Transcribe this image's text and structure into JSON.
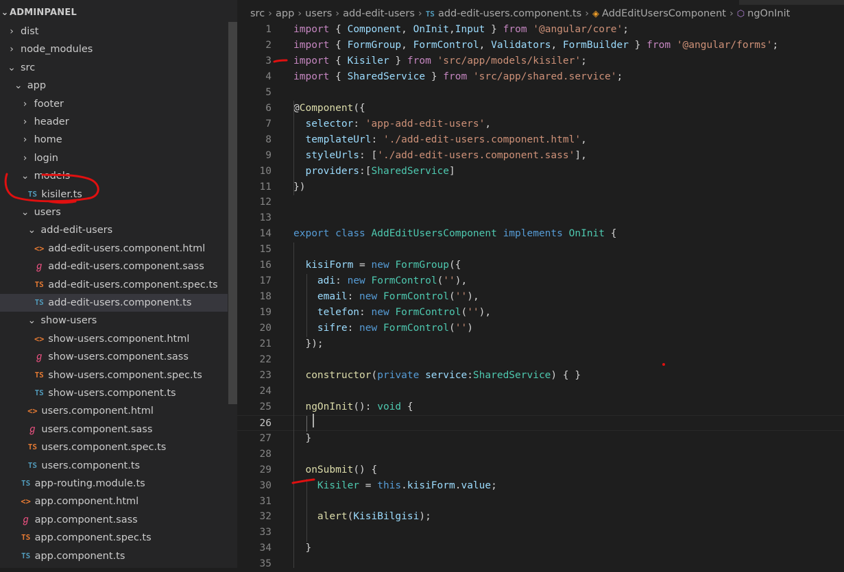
{
  "explorer": {
    "title": "ADMINPANEL",
    "items": [
      {
        "label": "dist",
        "type": "folder",
        "expanded": false,
        "depth": 0
      },
      {
        "label": "node_modules",
        "type": "folder",
        "expanded": false,
        "depth": 0
      },
      {
        "label": "src",
        "type": "folder",
        "expanded": true,
        "depth": 0
      },
      {
        "label": "app",
        "type": "folder",
        "expanded": true,
        "depth": 1
      },
      {
        "label": "footer",
        "type": "folder",
        "expanded": false,
        "depth": 2
      },
      {
        "label": "header",
        "type": "folder",
        "expanded": false,
        "depth": 2
      },
      {
        "label": "home",
        "type": "folder",
        "expanded": false,
        "depth": 2
      },
      {
        "label": "login",
        "type": "folder",
        "expanded": false,
        "depth": 2
      },
      {
        "label": "models",
        "type": "folder",
        "expanded": true,
        "depth": 2
      },
      {
        "label": "kisiler.ts",
        "type": "ts",
        "depth": 3
      },
      {
        "label": "users",
        "type": "folder",
        "expanded": true,
        "depth": 2
      },
      {
        "label": "add-edit-users",
        "type": "folder",
        "expanded": true,
        "depth": 3
      },
      {
        "label": "add-edit-users.component.html",
        "type": "html",
        "depth": 4
      },
      {
        "label": "add-edit-users.component.sass",
        "type": "sass",
        "depth": 4
      },
      {
        "label": "add-edit-users.component.spec.ts",
        "type": "spec",
        "depth": 4
      },
      {
        "label": "add-edit-users.component.ts",
        "type": "ts",
        "depth": 4,
        "selected": true
      },
      {
        "label": "show-users",
        "type": "folder",
        "expanded": true,
        "depth": 3
      },
      {
        "label": "show-users.component.html",
        "type": "html",
        "depth": 4
      },
      {
        "label": "show-users.component.sass",
        "type": "sass",
        "depth": 4
      },
      {
        "label": "show-users.component.spec.ts",
        "type": "spec",
        "depth": 4
      },
      {
        "label": "show-users.component.ts",
        "type": "ts",
        "depth": 4
      },
      {
        "label": "users.component.html",
        "type": "html",
        "depth": 3
      },
      {
        "label": "users.component.sass",
        "type": "sass",
        "depth": 3
      },
      {
        "label": "users.component.spec.ts",
        "type": "spec",
        "depth": 3
      },
      {
        "label": "users.component.ts",
        "type": "ts",
        "depth": 3
      },
      {
        "label": "app-routing.module.ts",
        "type": "ts",
        "depth": 2
      },
      {
        "label": "app.component.html",
        "type": "html",
        "depth": 2
      },
      {
        "label": "app.component.sass",
        "type": "sass",
        "depth": 2
      },
      {
        "label": "app.component.spec.ts",
        "type": "spec",
        "depth": 2
      },
      {
        "label": "app.component.ts",
        "type": "ts",
        "depth": 2
      }
    ]
  },
  "breadcrumb": {
    "parts": [
      "src",
      "app",
      "users",
      "add-edit-users"
    ],
    "file": "add-edit-users.component.ts",
    "file_icon": "TS",
    "class_name": "AddEditUsersComponent",
    "method_name": "ngOnInit"
  },
  "editor": {
    "current_line": 26,
    "lines": [
      [
        [
          "k",
          "import"
        ],
        [
          "p",
          " { "
        ],
        [
          "v",
          "Component"
        ],
        [
          "p",
          ", "
        ],
        [
          "v",
          "OnInit"
        ],
        [
          "p",
          ","
        ],
        [
          "v",
          "Input"
        ],
        [
          "p",
          " } "
        ],
        [
          "k",
          "from"
        ],
        [
          "p",
          " "
        ],
        [
          "s",
          "'@angular/core'"
        ],
        [
          "p",
          ";"
        ]
      ],
      [
        [
          "k",
          "import"
        ],
        [
          "p",
          " { "
        ],
        [
          "v",
          "FormGroup"
        ],
        [
          "p",
          ", "
        ],
        [
          "v",
          "FormControl"
        ],
        [
          "p",
          ", "
        ],
        [
          "v",
          "Validators"
        ],
        [
          "p",
          ", "
        ],
        [
          "v",
          "FormBuilder"
        ],
        [
          "p",
          " } "
        ],
        [
          "k",
          "from"
        ],
        [
          "p",
          " "
        ],
        [
          "s",
          "'@angular/forms'"
        ],
        [
          "p",
          ";"
        ]
      ],
      [
        [
          "k",
          "import"
        ],
        [
          "p",
          " { "
        ],
        [
          "v",
          "Kisiler"
        ],
        [
          "p",
          " } "
        ],
        [
          "k",
          "from"
        ],
        [
          "p",
          " "
        ],
        [
          "s",
          "'src/app/models/kisiler'"
        ],
        [
          "p",
          ";"
        ]
      ],
      [
        [
          "k",
          "import"
        ],
        [
          "p",
          " { "
        ],
        [
          "v",
          "SharedService"
        ],
        [
          "p",
          " } "
        ],
        [
          "k",
          "from"
        ],
        [
          "p",
          " "
        ],
        [
          "s",
          "'src/app/shared.service'"
        ],
        [
          "p",
          ";"
        ]
      ],
      [],
      [
        [
          "p",
          "@"
        ],
        [
          "f",
          "Component"
        ],
        [
          "p",
          "({"
        ]
      ],
      [
        [
          "p",
          "  "
        ],
        [
          "v",
          "selector"
        ],
        [
          "p",
          ": "
        ],
        [
          "s",
          "'app-add-edit-users'"
        ],
        [
          "p",
          ","
        ]
      ],
      [
        [
          "p",
          "  "
        ],
        [
          "v",
          "templateUrl"
        ],
        [
          "p",
          ": "
        ],
        [
          "s",
          "'./add-edit-users.component.html'"
        ],
        [
          "p",
          ","
        ]
      ],
      [
        [
          "p",
          "  "
        ],
        [
          "v",
          "styleUrls"
        ],
        [
          "p",
          ": ["
        ],
        [
          "s",
          "'./add-edit-users.component.sass'"
        ],
        [
          "p",
          "],"
        ]
      ],
      [
        [
          "p",
          "  "
        ],
        [
          "v",
          "providers"
        ],
        [
          "p",
          ":["
        ],
        [
          "c",
          "SharedService"
        ],
        [
          "p",
          "]"
        ]
      ],
      [
        [
          "p",
          "})"
        ]
      ],
      [],
      [],
      [
        [
          "kw",
          "export"
        ],
        [
          "p",
          " "
        ],
        [
          "kw",
          "class"
        ],
        [
          "p",
          " "
        ],
        [
          "c",
          "AddEditUsersComponent"
        ],
        [
          "p",
          " "
        ],
        [
          "kw",
          "implements"
        ],
        [
          "p",
          " "
        ],
        [
          "c",
          "OnInit"
        ],
        [
          "p",
          " {"
        ]
      ],
      [],
      [
        [
          "p",
          "  "
        ],
        [
          "v",
          "kisiForm"
        ],
        [
          "p",
          " = "
        ],
        [
          "kw",
          "new"
        ],
        [
          "p",
          " "
        ],
        [
          "c",
          "FormGroup"
        ],
        [
          "p",
          "({"
        ]
      ],
      [
        [
          "p",
          "    "
        ],
        [
          "v",
          "adi"
        ],
        [
          "p",
          ": "
        ],
        [
          "kw",
          "new"
        ],
        [
          "p",
          " "
        ],
        [
          "c",
          "FormControl"
        ],
        [
          "p",
          "("
        ],
        [
          "s",
          "''"
        ],
        [
          "p",
          "),"
        ]
      ],
      [
        [
          "p",
          "    "
        ],
        [
          "v",
          "email"
        ],
        [
          "p",
          ": "
        ],
        [
          "kw",
          "new"
        ],
        [
          "p",
          " "
        ],
        [
          "c",
          "FormControl"
        ],
        [
          "p",
          "("
        ],
        [
          "s",
          "''"
        ],
        [
          "p",
          "),"
        ]
      ],
      [
        [
          "p",
          "    "
        ],
        [
          "v",
          "telefon"
        ],
        [
          "p",
          ": "
        ],
        [
          "kw",
          "new"
        ],
        [
          "p",
          " "
        ],
        [
          "c",
          "FormControl"
        ],
        [
          "p",
          "("
        ],
        [
          "s",
          "''"
        ],
        [
          "p",
          "),"
        ]
      ],
      [
        [
          "p",
          "    "
        ],
        [
          "v",
          "sifre"
        ],
        [
          "p",
          ": "
        ],
        [
          "kw",
          "new"
        ],
        [
          "p",
          " "
        ],
        [
          "c",
          "FormControl"
        ],
        [
          "p",
          "("
        ],
        [
          "s",
          "''"
        ],
        [
          "p",
          ")"
        ]
      ],
      [
        [
          "p",
          "  });"
        ]
      ],
      [],
      [
        [
          "p",
          "  "
        ],
        [
          "f",
          "constructor"
        ],
        [
          "p",
          "("
        ],
        [
          "kw",
          "private"
        ],
        [
          "p",
          " "
        ],
        [
          "v",
          "service"
        ],
        [
          "p",
          ":"
        ],
        [
          "c",
          "SharedService"
        ],
        [
          "p",
          ") { }"
        ]
      ],
      [],
      [
        [
          "p",
          "  "
        ],
        [
          "f",
          "ngOnInit"
        ],
        [
          "p",
          "(): "
        ],
        [
          "c",
          "void"
        ],
        [
          "p",
          " {"
        ]
      ],
      [],
      [
        [
          "p",
          "  }"
        ]
      ],
      [],
      [
        [
          "p",
          "  "
        ],
        [
          "f",
          "onSubmit"
        ],
        [
          "p",
          "() {"
        ]
      ],
      [
        [
          "p",
          "    "
        ],
        [
          "c",
          "Kisiler"
        ],
        [
          "p",
          " = "
        ],
        [
          "kw",
          "this"
        ],
        [
          "p",
          "."
        ],
        [
          "v",
          "kisiForm"
        ],
        [
          "p",
          "."
        ],
        [
          "v",
          "value"
        ],
        [
          "p",
          ";"
        ]
      ],
      [],
      [
        [
          "p",
          "    "
        ],
        [
          "f",
          "alert"
        ],
        [
          "p",
          "("
        ],
        [
          "v",
          "KisiBilgisi"
        ],
        [
          "p",
          ");"
        ]
      ],
      [],
      [
        [
          "p",
          "  }"
        ]
      ],
      []
    ]
  },
  "colors": {
    "annotation": "#e01010",
    "keyword_control": "#c586c0",
    "keyword": "#569cd6",
    "string": "#ce9178",
    "type": "#4ec9b0",
    "function": "#dcdcaa",
    "variable": "#9cdcfe"
  }
}
